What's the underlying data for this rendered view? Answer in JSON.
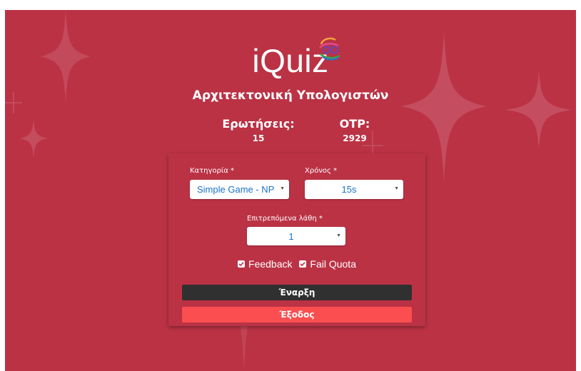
{
  "app": {
    "logo_text": "iQuiz"
  },
  "quiz": {
    "title": "Αρχιτεκτονική Υπολογιστών"
  },
  "stats": {
    "questions_label": "Ερωτήσεις:",
    "questions_value": "15",
    "otp_label": "OTP:",
    "otp_value": "2929"
  },
  "form": {
    "category_label": "Κατηγορία *",
    "category_value": "Simple Game - NP",
    "time_label": "Χρόνος *",
    "time_value": "15s",
    "mistakes_label": "Επιτρεπόμενα λάθη *",
    "mistakes_value": "1",
    "feedback_label": "Feedback",
    "feedback_checked": true,
    "fail_quota_label": "Fail Quota",
    "fail_quota_checked": true,
    "start_label": "Έναρξη",
    "exit_label": "Έξοδος"
  },
  "colors": {
    "background": "#bb3245",
    "start_button": "#303030",
    "exit_button": "#fb4e50",
    "select_text": "#1a73c8"
  }
}
